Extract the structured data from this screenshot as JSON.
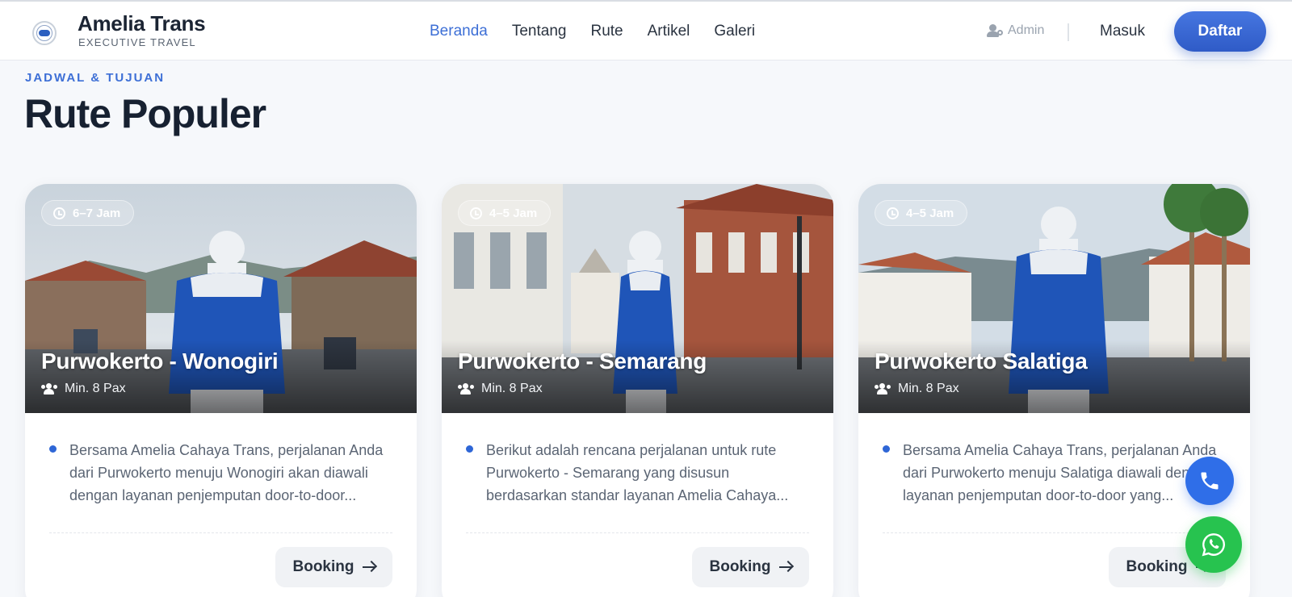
{
  "header": {
    "brand_name": "Amelia Trans",
    "brand_sub": "EXECUTIVE TRAVEL",
    "nav": [
      {
        "label": "Beranda",
        "active": true
      },
      {
        "label": "Tentang"
      },
      {
        "label": "Rute"
      },
      {
        "label": "Artikel"
      },
      {
        "label": "Galeri"
      }
    ],
    "admin_label": "Admin",
    "login_label": "Masuk",
    "register_label": "Daftar"
  },
  "section": {
    "eyebrow": "JADWAL & TUJUAN",
    "title": "Rute Populer"
  },
  "routes": [
    {
      "duration": "6–7 Jam",
      "title": "Purwokerto - Wonogiri",
      "pax": "Min. 8 Pax",
      "description": "Bersama Amelia Cahaya Trans, perjalanan Anda dari Purwokerto menuju Wonogiri akan diawali dengan layanan penjemputan door-to-door...",
      "booking_label": "Booking"
    },
    {
      "duration": "4–5 Jam",
      "title": "Purwokerto - Semarang",
      "pax": "Min. 8 Pax",
      "description": "Berikut adalah rencana perjalanan untuk rute Purwokerto - Semarang yang disusun berdasarkan standar layanan Amelia Cahaya...",
      "booking_label": "Booking"
    },
    {
      "duration": "4–5 Jam",
      "title": "Purwokerto Salatiga",
      "pax": "Min. 8 Pax",
      "description": "Bersama Amelia Cahaya Trans, perjalanan Anda dari Purwokerto menuju Salatiga diawali dengan layanan penjemputan door-to-door yang...",
      "booking_label": "Booking"
    }
  ],
  "icons": {
    "phone": "phone-icon",
    "whatsapp": "whatsapp-icon"
  },
  "colors": {
    "accent": "#3d6fd6",
    "whatsapp": "#27c34f",
    "phone": "#2f6ee8"
  }
}
